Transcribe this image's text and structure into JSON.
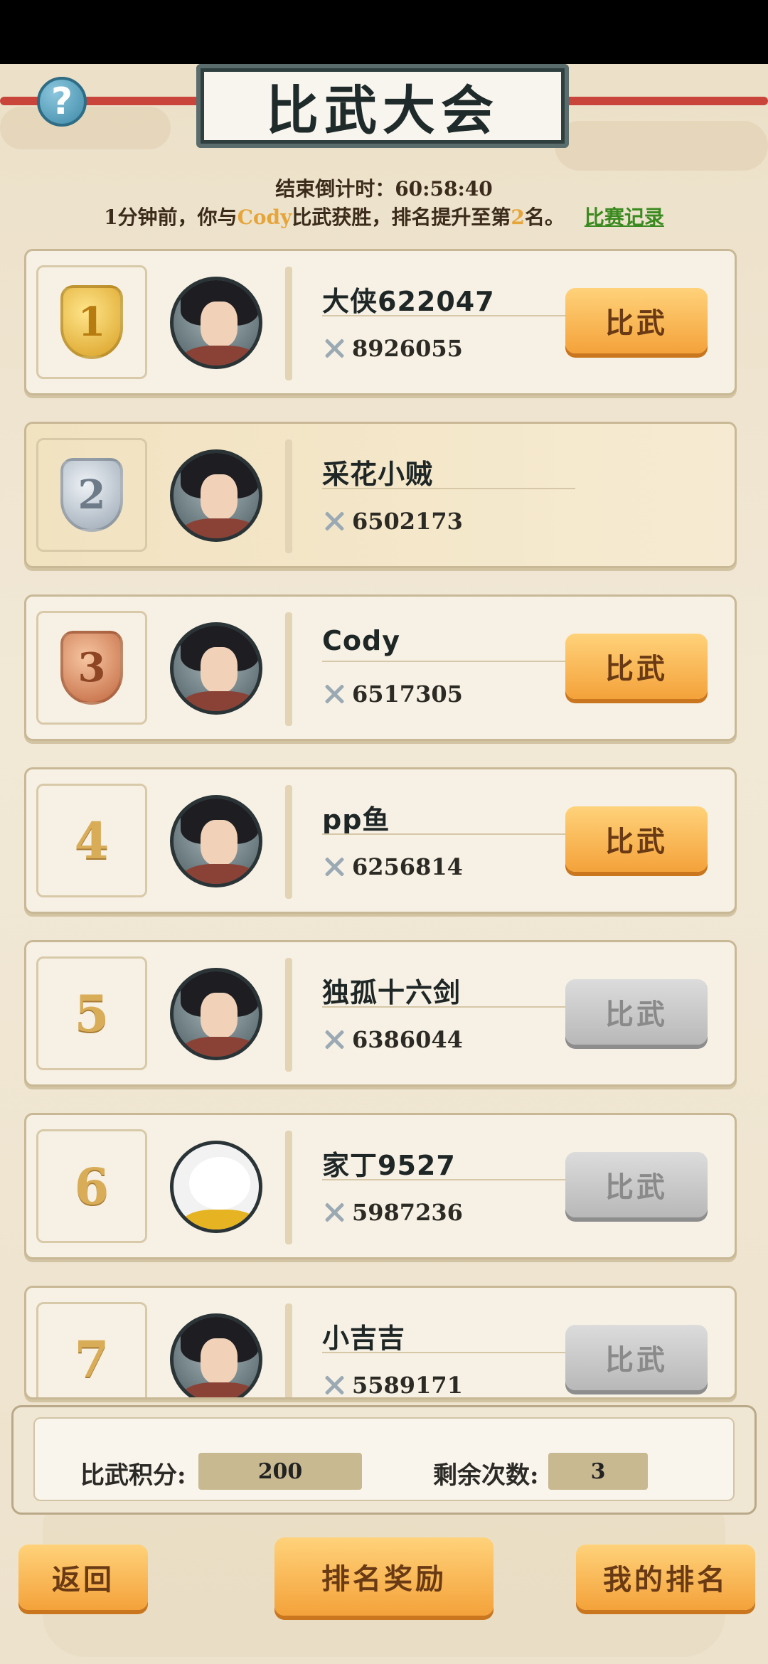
{
  "header": {
    "title": "比武大会",
    "help_label": "?",
    "countdown": "结束倒计时：60:58:40",
    "notice_pre": "1分钟前，你与",
    "notice_opponent": "Cody",
    "notice_mid": "比武获胜，排名提升至第",
    "notice_rank": "2",
    "notice_post": "名。",
    "record_link": "比赛记录"
  },
  "rows": [
    {
      "rank": "1",
      "name": "大侠622047",
      "power": "8926055",
      "button": "比武",
      "enabled": true
    },
    {
      "rank": "2",
      "name": "采花小贼",
      "power": "6502173",
      "button": "",
      "enabled": false,
      "is_me": true
    },
    {
      "rank": "3",
      "name": "Cody",
      "power": "6517305",
      "button": "比武",
      "enabled": true
    },
    {
      "rank": "4",
      "name": "pp鱼",
      "power": "6256814",
      "button": "比武",
      "enabled": true
    },
    {
      "rank": "5",
      "name": "独孤十六剑",
      "power": "6386044",
      "button": "比武",
      "enabled": false
    },
    {
      "rank": "6",
      "name": "家丁9527",
      "power": "5987236",
      "button": "比武",
      "enabled": false
    },
    {
      "rank": "7",
      "name": "小吉吉",
      "power": "5589171",
      "button": "比武",
      "enabled": false
    }
  ],
  "stats": {
    "points_label": "比武积分:",
    "points_value": "200",
    "remaining_label": "剩余次数:",
    "remaining_value": "3"
  },
  "footer": {
    "back_label": "返回",
    "rewards_label": "排名奖励",
    "my_rank_label": "我的排名"
  },
  "colors": {
    "accent_button": "#f4a23a",
    "disabled_button": "#b8b8b8",
    "highlight_text": "#e6a53a",
    "link_text": "#3a8a1f"
  }
}
